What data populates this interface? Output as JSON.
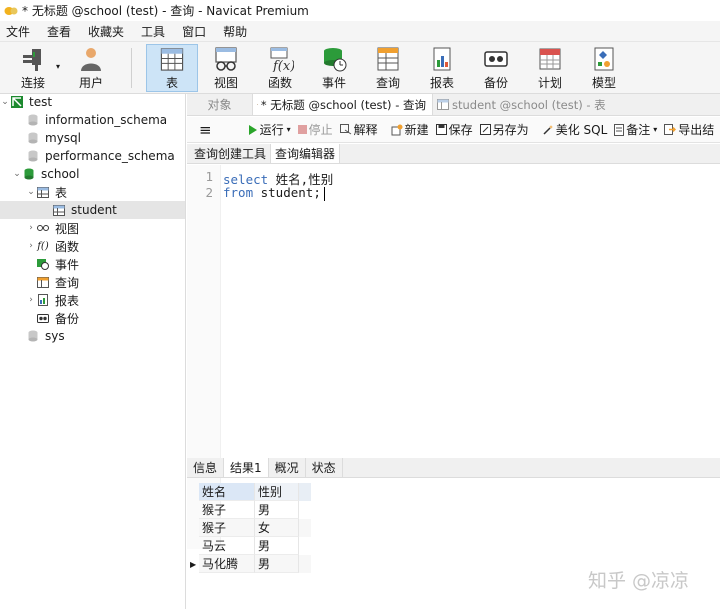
{
  "window": {
    "title": "* 无标题 @school (test) - 查询 - Navicat Premium"
  },
  "menu": [
    "文件",
    "查看",
    "收藏夹",
    "工具",
    "窗口",
    "帮助"
  ],
  "toolbar": {
    "connect": "连接",
    "user": "用户",
    "table": "表",
    "view": "视图",
    "function": "函数",
    "event": "事件",
    "query": "查询",
    "report": "报表",
    "backup": "备份",
    "schedule": "计划",
    "model": "模型"
  },
  "tree": {
    "connection": "test",
    "databases": [
      "information_schema",
      "mysql",
      "performance_schema"
    ],
    "current_db": "school",
    "tables_label": "表",
    "table_item": "student",
    "groups": [
      "视图",
      "函数",
      "事件",
      "查询",
      "报表",
      "备份"
    ],
    "last_db": "sys"
  },
  "tabs": {
    "objects": "对象",
    "query_tab": "* 无标题 @school (test) - 查询",
    "table_tab": "student @school (test) - 表"
  },
  "query_toolbar": {
    "run": "运行",
    "stop": "停止",
    "explain": "解释",
    "new": "新建",
    "save": "保存",
    "save_as": "另存为",
    "beautify": "美化 SQL",
    "comment": "备注",
    "export": "导出结"
  },
  "subtabs": {
    "builder": "查询创建工具",
    "editor": "查询编辑器"
  },
  "editor": {
    "line1_num": "1",
    "line1_kw": "select",
    "line1_rest": " 姓名,性别",
    "line2_num": "2",
    "line2_kw": "from",
    "line2_rest": " student;"
  },
  "result_tabs": {
    "info": "信息",
    "result": "结果1",
    "profile": "概况",
    "status": "状态"
  },
  "results": {
    "columns": [
      "姓名",
      "性别"
    ],
    "rows": [
      [
        "猴子",
        "男"
      ],
      [
        "猴子",
        "女"
      ],
      [
        "马云",
        "男"
      ],
      [
        "马化腾",
        "男"
      ]
    ]
  },
  "watermark": "知乎 @凉凉",
  "colors": {
    "keyword": "#3a6db8",
    "run_green": "#2aa52a",
    "db_green": "#2c9b3a"
  }
}
